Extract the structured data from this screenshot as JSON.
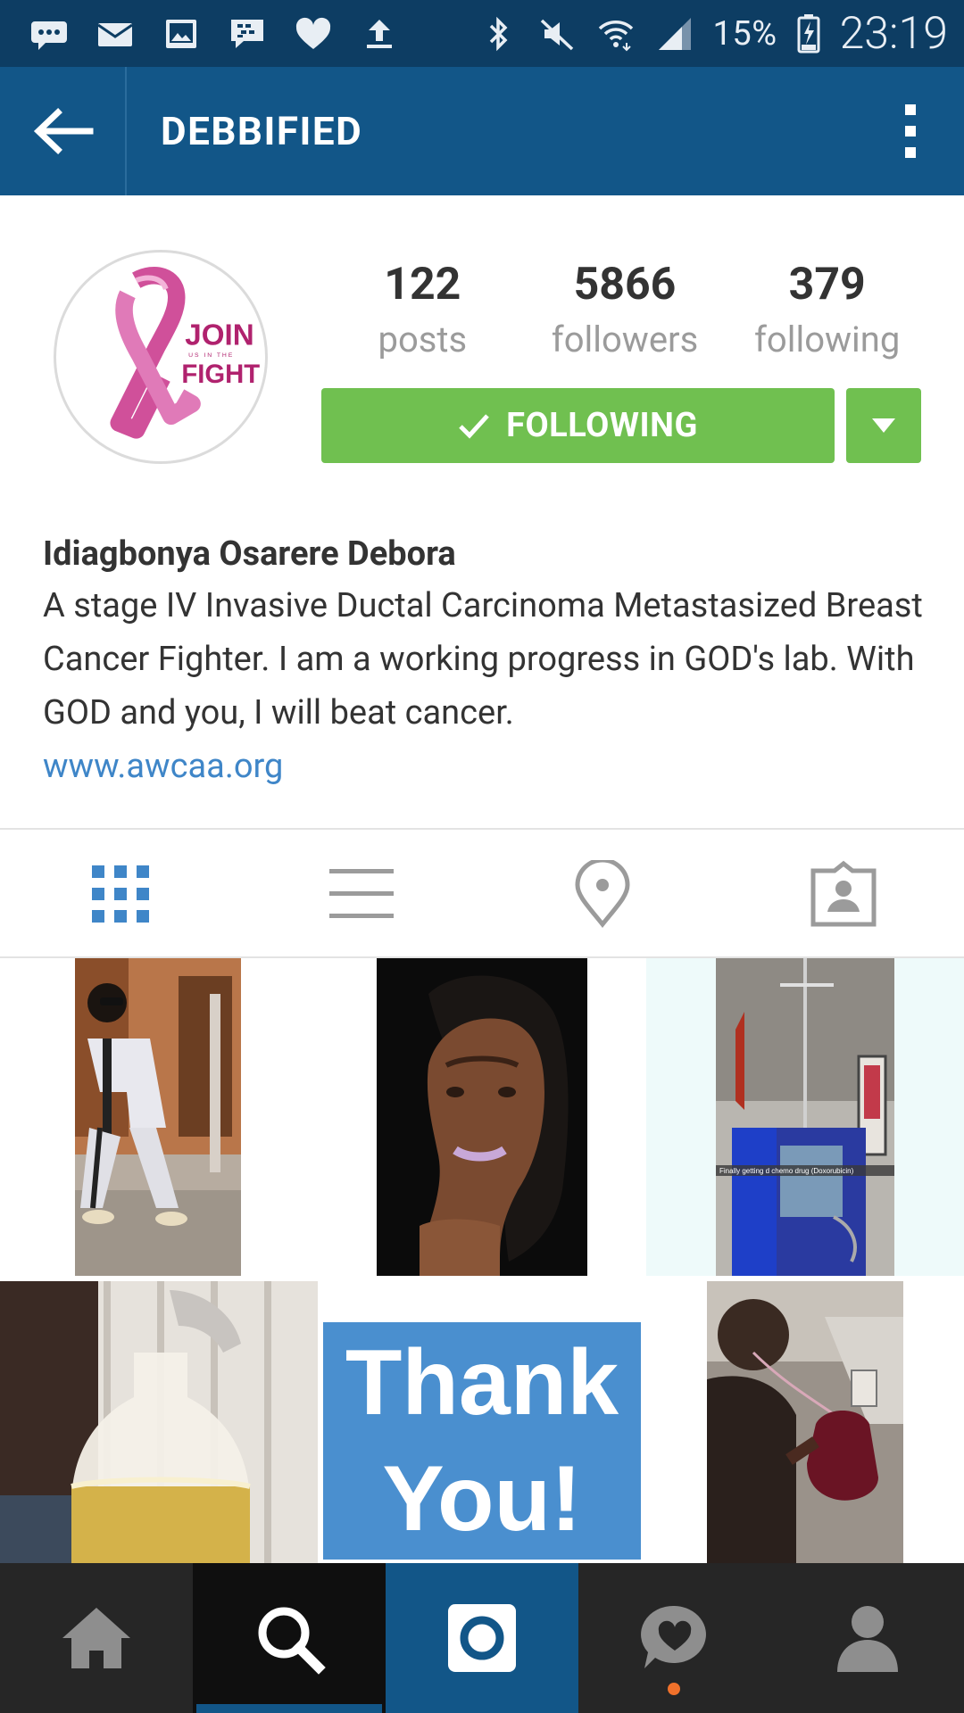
{
  "status_bar": {
    "icons": [
      "message-icon",
      "mail-icon",
      "gallery-icon",
      "bbm-icon",
      "heart-icon",
      "upload-icon",
      "bluetooth-icon",
      "mute-icon",
      "wifi-icon",
      "signal-icon",
      "battery-icon"
    ],
    "battery": "15%",
    "time": "23:19"
  },
  "app_bar": {
    "title": "DEBBIFIED",
    "back_icon": "back-arrow-icon",
    "menu_icon": "more-vertical-icon"
  },
  "profile": {
    "avatar": {
      "logo_text_line1": "JOIN",
      "logo_text_small": "US IN THE",
      "logo_text_line2": "FIGHT"
    },
    "stats": [
      {
        "value": "122",
        "label": "posts"
      },
      {
        "value": "5866",
        "label": "followers"
      },
      {
        "value": "379",
        "label": "following"
      }
    ],
    "follow_button": "FOLLOWING",
    "name": "Idiagbonya Osarere Debora",
    "bio": "A stage IV Invasive Ductal Carcinoma Metastasized Breast Cancer Fighter. I am a working progress in GOD's lab. With GOD and you, I will beat cancer.",
    "link": "www.awcaa.org"
  },
  "tabs": [
    {
      "icon": "grid-icon",
      "active": true
    },
    {
      "icon": "list-icon",
      "active": false
    },
    {
      "icon": "location-pin-icon",
      "active": false
    },
    {
      "icon": "tagged-photos-icon",
      "active": false
    }
  ],
  "posts": {
    "thank_you_line1": "Thank",
    "thank_you_line2": "You!",
    "iv_caption": "Finally getting d chemo drug (Doxorubicin)"
  },
  "bottom_nav": [
    {
      "icon": "home-icon"
    },
    {
      "icon": "search-icon",
      "active": true
    },
    {
      "icon": "camera-icon"
    },
    {
      "icon": "activity-heart-icon"
    },
    {
      "icon": "profile-icon"
    }
  ],
  "colors": {
    "status_bar": "#0d3d63",
    "app_bar": "#125688",
    "following_green": "#70c050",
    "link_blue": "#3f86c8",
    "tab_active": "#3f86c8",
    "bottom_nav": "#262626"
  }
}
